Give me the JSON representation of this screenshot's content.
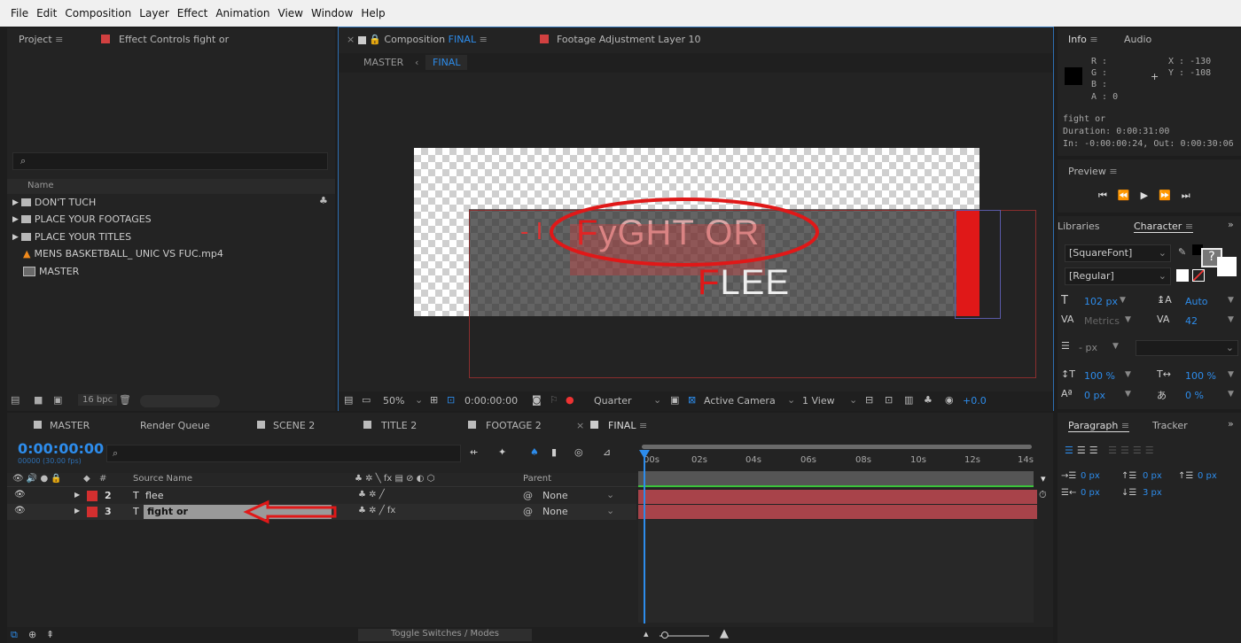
{
  "menu": [
    "File",
    "Edit",
    "Composition",
    "Layer",
    "Effect",
    "Animation",
    "View",
    "Window",
    "Help"
  ],
  "project_panel": {
    "tab_project": "Project",
    "tab_effect_controls": "Effect Controls fight or",
    "search_placeholder": "",
    "col_name": "Name",
    "items": [
      {
        "name": "DON'T TUCH",
        "type": "folder"
      },
      {
        "name": "PLACE YOUR FOOTAGES",
        "type": "folder"
      },
      {
        "name": "PLACE YOUR TITLES",
        "type": "folder"
      },
      {
        "name": "MENS BASKETBALL_ UNIC VS FUC.mp4",
        "type": "video"
      },
      {
        "name": "MASTER",
        "type": "composition"
      }
    ],
    "bpc": "16 bpc"
  },
  "comp_panel": {
    "tab_comp_prefix": "Composition",
    "tab_comp_name": "FINAL",
    "tab_footage": "Footage Adjustment Layer 10",
    "nav_master": "MASTER",
    "nav_final": "FINAL",
    "text_line1_first": "F",
    "text_line1_rest": "yGHT OR",
    "text_line2_first": "F",
    "text_line2_rest": "LEE",
    "text_dash": "- I",
    "zoom": "50%",
    "timecode": "0:00:00:00",
    "resolution": "Quarter",
    "camera": "Active Camera",
    "views": "1 View",
    "exposure": "+0.0"
  },
  "info_panel": {
    "tab_info": "Info",
    "tab_audio": "Audio",
    "r": "R :",
    "g": "G :",
    "b": "B :",
    "a": "A : 0",
    "x": "X : -130",
    "y": "Y : -108",
    "layer_name": "fight or",
    "duration": "Duration: 0:00:31:00",
    "in_out": "In: -0:00:00:24, Out: 0:00:30:06"
  },
  "preview_panel": {
    "title": "Preview"
  },
  "character_panel": {
    "tab_libraries": "Libraries",
    "tab_character": "Character",
    "font": "[SquareFont]",
    "style": "[Regular]",
    "font_size": "102 px",
    "leading": "Auto",
    "kerning": "Metrics",
    "tracking": "42",
    "stroke": "- px",
    "vscale": "100 %",
    "hscale": "100 %",
    "baseline": "0 px",
    "tsume": "0 %"
  },
  "paragraph_panel": {
    "tab_paragraph": "Paragraph",
    "tab_tracker": "Tracker",
    "indent_left": "0 px",
    "indent_first": "0 px",
    "space_before": "0 px",
    "indent_right": "0 px",
    "space_after": "3 px"
  },
  "timeline": {
    "tabs": [
      "MASTER",
      "Render Queue",
      "SCENE 2",
      "TITLE 2",
      "FOOTAGE 2",
      "FINAL"
    ],
    "timecode": "0:00:00:00",
    "fps": "00000 (30.00 fps)",
    "col_source": "Source Name",
    "col_parent": "Parent",
    "col_hash": "#",
    "layers": [
      {
        "num": "2",
        "name": "flee",
        "parent": "None"
      },
      {
        "num": "3",
        "name": "fight or",
        "parent": "None"
      }
    ],
    "ruler": [
      "00s",
      "02s",
      "04s",
      "06s",
      "08s",
      "10s",
      "12s",
      "14s"
    ],
    "toggle": "Toggle Switches / Modes"
  },
  "colors": {
    "accent": "#2d8ceb",
    "red": "#e01818",
    "label_red": "#d32f2f",
    "bar_red": "#a8434a"
  }
}
